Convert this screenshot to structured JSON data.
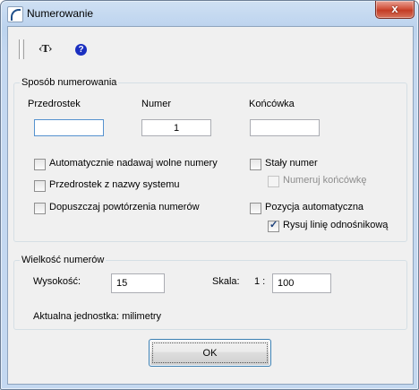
{
  "window": {
    "title": "Numerowanie",
    "close_glyph": "x"
  },
  "toolbar": {
    "icons": [
      "toolbar-handle",
      "tag-icon",
      "help-icon"
    ],
    "tag_glyph": "‹T›",
    "help_glyph": "?"
  },
  "numbering": {
    "legend": "Sposób numerowania",
    "prefix_label": "Przedrostek",
    "prefix_value": "",
    "number_label": "Numer",
    "number_value": "1",
    "suffix_label": "Końcówka",
    "suffix_value": "",
    "options": {
      "auto_free": {
        "label": "Automatycznie nadawaj wolne numery",
        "checked": false
      },
      "prefix_system": {
        "label": "Przedrostek z nazwy systemu",
        "checked": false
      },
      "allow_duplicates": {
        "label": "Dopuszczaj powtórzenia numerów",
        "checked": false
      },
      "fixed_number": {
        "label": "Stały numer",
        "checked": false
      },
      "number_suffix": {
        "label": "Numeruj końcówkę",
        "checked": false,
        "disabled": true
      },
      "auto_position": {
        "label": "Pozycja automatyczna",
        "checked": false
      },
      "leader_line": {
        "label": "Rysuj linię odnośnikową",
        "checked": true
      }
    }
  },
  "size": {
    "legend": "Wielkość numerów",
    "height_label": "Wysokość:",
    "height_value": "15",
    "scale_label": "Skala:",
    "scale_prefix": "1 :",
    "scale_value": "100",
    "unit_text": "Aktualna jednostka: milimetry"
  },
  "buttons": {
    "ok": "OK"
  }
}
